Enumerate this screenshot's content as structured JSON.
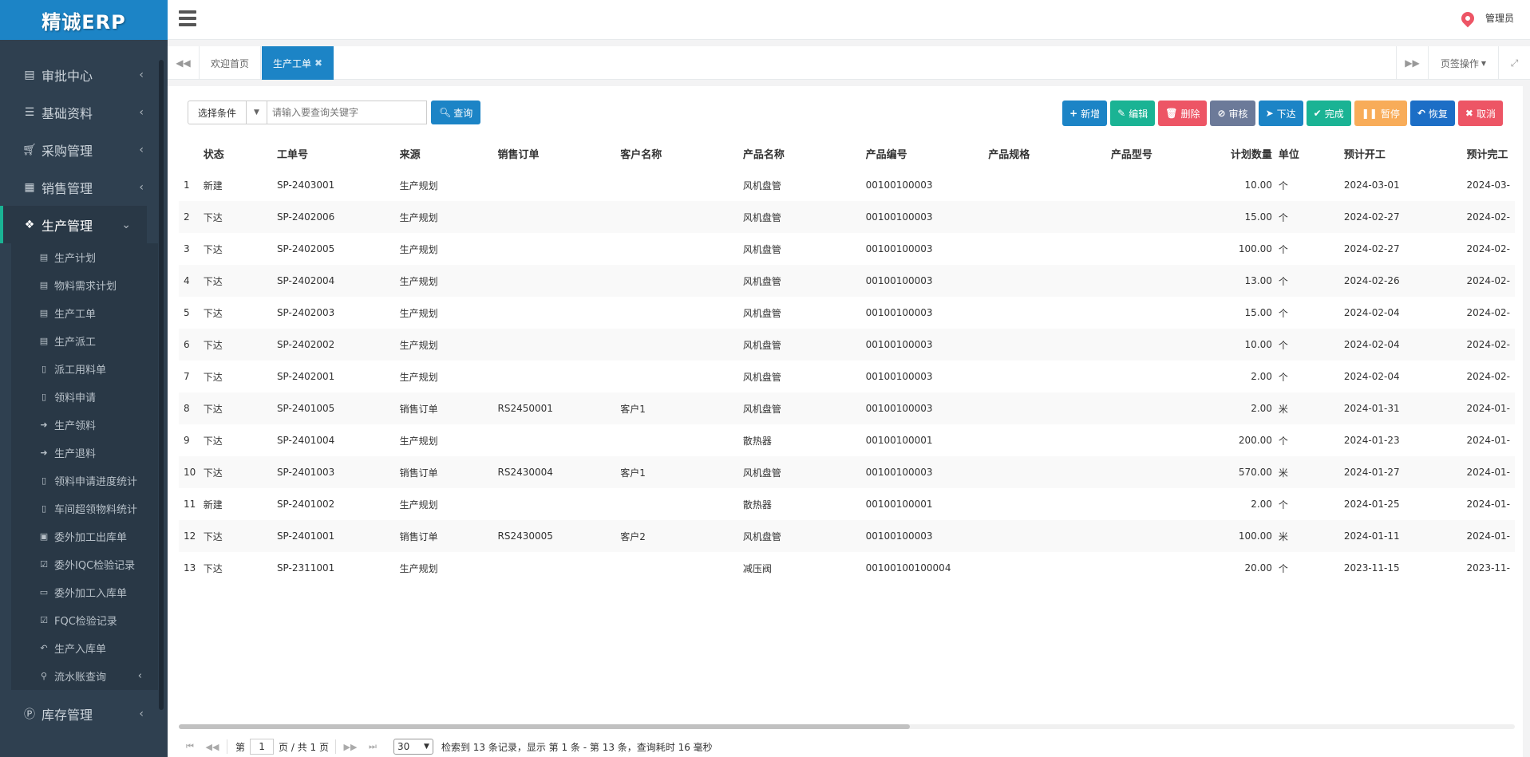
{
  "app": {
    "logo": "精诚ERP",
    "user": "管理员"
  },
  "sidebar": {
    "items": [
      {
        "label": "审批中心",
        "icon": "server-icon"
      },
      {
        "label": "基础资料",
        "icon": "list-icon"
      },
      {
        "label": "采购管理",
        "icon": "cart-icon"
      },
      {
        "label": "销售管理",
        "icon": "building-icon"
      },
      {
        "label": "生产管理",
        "icon": "cubes-icon",
        "active": true
      }
    ],
    "sub_items": [
      {
        "label": "生产计划",
        "icon": "server-icon"
      },
      {
        "label": "物料需求计划",
        "icon": "server-icon"
      },
      {
        "label": "生产工单",
        "icon": "server-icon"
      },
      {
        "label": "生产派工",
        "icon": "server-icon"
      },
      {
        "label": "派工用料单",
        "icon": "file-icon"
      },
      {
        "label": "领料申请",
        "icon": "file-icon"
      },
      {
        "label": "生产领料",
        "icon": "sign-in-icon"
      },
      {
        "label": "生产退料",
        "icon": "sign-in-icon"
      },
      {
        "label": "领料申请进度统计",
        "icon": "file-icon"
      },
      {
        "label": "车间超领物料统计",
        "icon": "file-icon"
      },
      {
        "label": "委外加工出库单",
        "icon": "briefcase-icon"
      },
      {
        "label": "委外IQC检验记录",
        "icon": "check-square-icon"
      },
      {
        "label": "委外加工入库单",
        "icon": "inbox-icon"
      },
      {
        "label": "FQC检验记录",
        "icon": "check-square-icon"
      },
      {
        "label": "生产入库单",
        "icon": "reply-icon"
      },
      {
        "label": "流水账查询",
        "icon": "search-icon"
      }
    ],
    "bottom_item": {
      "label": "库存管理",
      "icon": "p-circle-icon"
    }
  },
  "tabs": {
    "home": "欢迎首页",
    "current": "生产工单",
    "ops": "页签操作"
  },
  "toolbar": {
    "condition": "选择条件",
    "search_placeholder": "请输入要查询关键字",
    "search_button": "查询"
  },
  "actions": [
    {
      "label": "新增",
      "icon": "+",
      "color": "#1c84c6"
    },
    {
      "label": "编辑",
      "icon": "✎",
      "color": "#1ab394"
    },
    {
      "label": "删除",
      "icon": "🗑",
      "color": "#ed5565"
    },
    {
      "label": "审核",
      "icon": "⊘",
      "color": "#6c7a99"
    },
    {
      "label": "下达",
      "icon": "➤",
      "color": "#1c84c6"
    },
    {
      "label": "完成",
      "icon": "✔",
      "color": "#1ab394"
    },
    {
      "label": "暂停",
      "icon": "❚❚",
      "color": "#f8ac59"
    },
    {
      "label": "恢复",
      "icon": "↶",
      "color": "#1c6ec6"
    },
    {
      "label": "取消",
      "icon": "✖",
      "color": "#ed5565"
    }
  ],
  "table": {
    "headers": [
      "",
      "状态",
      "工单号",
      "来源",
      "销售订单",
      "客户名称",
      "产品名称",
      "产品编号",
      "产品规格",
      "产品型号",
      "计划数量",
      "单位",
      "预计开工",
      "预计完工"
    ],
    "rows": [
      [
        "1",
        "新建",
        "SP-2403001",
        "生产规划",
        "",
        "",
        "风机盘管",
        "00100100003",
        "",
        "",
        "10.00",
        "个",
        "2024-03-01",
        "2024-03-"
      ],
      [
        "2",
        "下达",
        "SP-2402006",
        "生产规划",
        "",
        "",
        "风机盘管",
        "00100100003",
        "",
        "",
        "15.00",
        "个",
        "2024-02-27",
        "2024-02-"
      ],
      [
        "3",
        "下达",
        "SP-2402005",
        "生产规划",
        "",
        "",
        "风机盘管",
        "00100100003",
        "",
        "",
        "100.00",
        "个",
        "2024-02-27",
        "2024-02-"
      ],
      [
        "4",
        "下达",
        "SP-2402004",
        "生产规划",
        "",
        "",
        "风机盘管",
        "00100100003",
        "",
        "",
        "13.00",
        "个",
        "2024-02-26",
        "2024-02-"
      ],
      [
        "5",
        "下达",
        "SP-2402003",
        "生产规划",
        "",
        "",
        "风机盘管",
        "00100100003",
        "",
        "",
        "15.00",
        "个",
        "2024-02-04",
        "2024-02-"
      ],
      [
        "6",
        "下达",
        "SP-2402002",
        "生产规划",
        "",
        "",
        "风机盘管",
        "00100100003",
        "",
        "",
        "10.00",
        "个",
        "2024-02-04",
        "2024-02-"
      ],
      [
        "7",
        "下达",
        "SP-2402001",
        "生产规划",
        "",
        "",
        "风机盘管",
        "00100100003",
        "",
        "",
        "2.00",
        "个",
        "2024-02-04",
        "2024-02-"
      ],
      [
        "8",
        "下达",
        "SP-2401005",
        "销售订单",
        "RS2450001",
        "客户1",
        "风机盘管",
        "00100100003",
        "",
        "",
        "2.00",
        "米",
        "2024-01-31",
        "2024-01-"
      ],
      [
        "9",
        "下达",
        "SP-2401004",
        "生产规划",
        "",
        "",
        "散热器",
        "00100100001",
        "",
        "",
        "200.00",
        "个",
        "2024-01-23",
        "2024-01-"
      ],
      [
        "10",
        "下达",
        "SP-2401003",
        "销售订单",
        "RS2430004",
        "客户1",
        "风机盘管",
        "00100100003",
        "",
        "",
        "570.00",
        "米",
        "2024-01-27",
        "2024-01-"
      ],
      [
        "11",
        "新建",
        "SP-2401002",
        "生产规划",
        "",
        "",
        "散热器",
        "00100100001",
        "",
        "",
        "2.00",
        "个",
        "2024-01-25",
        "2024-01-"
      ],
      [
        "12",
        "下达",
        "SP-2401001",
        "销售订单",
        "RS2430005",
        "客户2",
        "风机盘管",
        "00100100003",
        "",
        "",
        "100.00",
        "米",
        "2024-01-11",
        "2024-01-"
      ],
      [
        "13",
        "下达",
        "SP-2311001",
        "生产规划",
        "",
        "",
        "减压阀",
        "00100100100004",
        "",
        "",
        "20.00",
        "个",
        "2023-11-15",
        "2023-11-"
      ]
    ]
  },
  "pager": {
    "page_label_pre": "第",
    "page_value": "1",
    "page_label_post": "页 / 共 1 页",
    "page_size": "30",
    "summary": "检索到 13 条记录，显示 第 1 条 - 第 13 条，查询耗时 16 毫秒"
  }
}
